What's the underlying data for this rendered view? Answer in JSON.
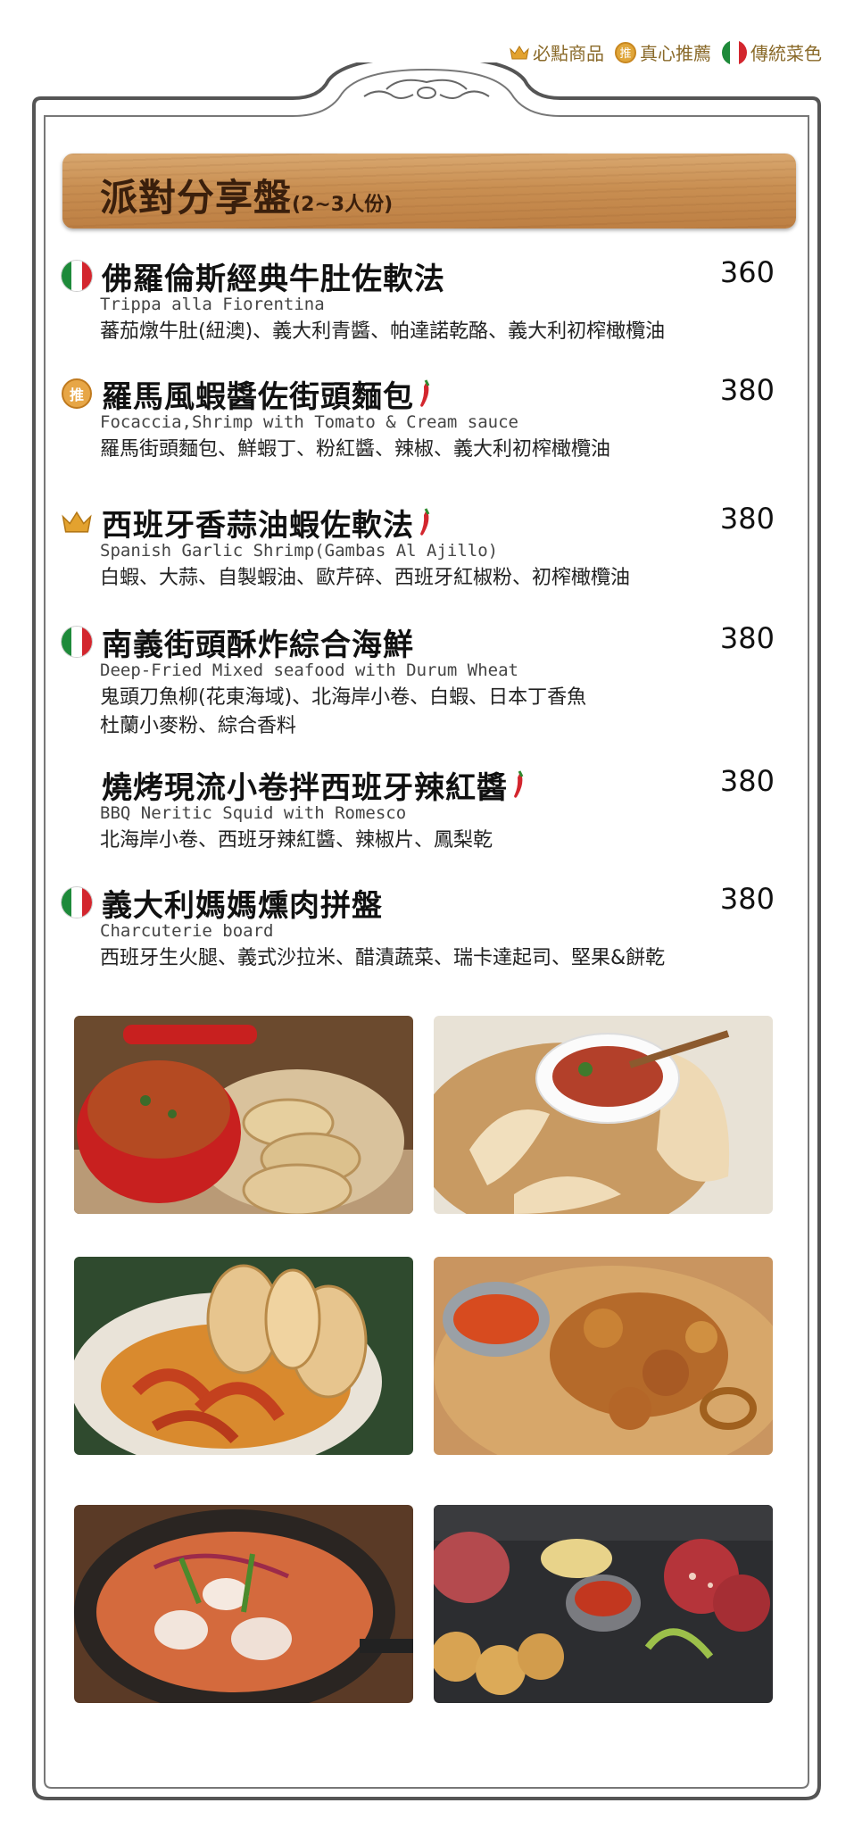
{
  "legend": [
    {
      "icon": "crown-icon",
      "label": "必點商品"
    },
    {
      "icon": "recommend-badge-icon",
      "label": "真心推薦"
    },
    {
      "icon": "italy-flag-icon",
      "label": "傳統菜色"
    }
  ],
  "section": {
    "title": "派對分享盤",
    "subtitle": "(2~3人份)"
  },
  "badge_char": "推",
  "items": [
    {
      "name": "佛羅倫斯經典牛肚佐軟法",
      "english": "Trippa alla Fiorentina",
      "description": "蕃茄燉牛肚(紐澳)、義大利青醬、帕達諾乾酪、義大利初榨橄欖油",
      "price": "360",
      "icon": "italy-flag-icon",
      "spicy": false
    },
    {
      "name": "羅馬風蝦醬佐街頭麵包",
      "english": "Focaccia,Shrimp with Tomato & Cream sauce",
      "description": "羅馬街頭麵包、鮮蝦丁、粉紅醬、辣椒、義大利初榨橄欖油",
      "price": "380",
      "icon": "recommend-badge-icon",
      "spicy": true
    },
    {
      "name": "西班牙香蒜油蝦佐軟法",
      "english": "Spanish Garlic Shrimp(Gambas Al Ajillo)",
      "description": "白蝦、大蒜、自製蝦油、歐芹碎、西班牙紅椒粉、初榨橄欖油",
      "price": "380",
      "icon": "crown-icon",
      "spicy": true
    },
    {
      "name": "南義街頭酥炸綜合海鮮",
      "english": "Deep-Fried Mixed seafood with Durum Wheat",
      "description": "鬼頭刀魚柳(花東海域)、北海岸小卷、白蝦、日本丁香魚",
      "description2": "杜蘭小麥粉、綜合香料",
      "price": "380",
      "icon": "italy-flag-icon",
      "spicy": false
    },
    {
      "name": "燒烤現流小卷拌西班牙辣紅醬",
      "english": "BBQ Neritic Squid with Romesco",
      "description": "北海岸小卷、西班牙辣紅醬、辣椒片、鳳梨乾",
      "price": "380",
      "icon": "",
      "spicy": true
    },
    {
      "name": "義大利媽媽燻肉拼盤",
      "english": "Charcuterie board",
      "description": "西班牙生火腿、義式沙拉米、醋漬蔬菜、瑞卡達起司、堅果&餅乾",
      "price": "380",
      "icon": "italy-flag-icon",
      "spicy": false
    }
  ],
  "colors": {
    "plank": "#c98f52",
    "frame": "#555555",
    "accent_gold": "#e0a63a",
    "chili": "#d3262e"
  }
}
